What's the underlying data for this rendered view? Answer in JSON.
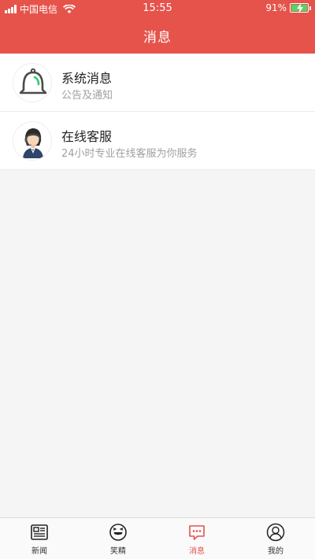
{
  "status_bar": {
    "carrier": "中国电信",
    "time": "15:55",
    "battery_percent": "91%",
    "battery_level": 0.91
  },
  "nav": {
    "title": "消息"
  },
  "list": {
    "items": [
      {
        "title": "系统消息",
        "subtitle": "公告及通知",
        "icon": "bell-icon"
      },
      {
        "title": "在线客服",
        "subtitle": "24小时专业在线客服为你服务",
        "icon": "customer-service-avatar"
      }
    ]
  },
  "tabbar": {
    "tabs": [
      {
        "label": "新闻",
        "icon": "newspaper-icon"
      },
      {
        "label": "笑精",
        "icon": "laugh-face-icon"
      },
      {
        "label": "消息",
        "icon": "chat-bubble-icon",
        "active": true
      },
      {
        "label": "我的",
        "icon": "user-icon"
      }
    ]
  },
  "colors": {
    "accent": "#e5534b",
    "battery": "#4cd964"
  }
}
